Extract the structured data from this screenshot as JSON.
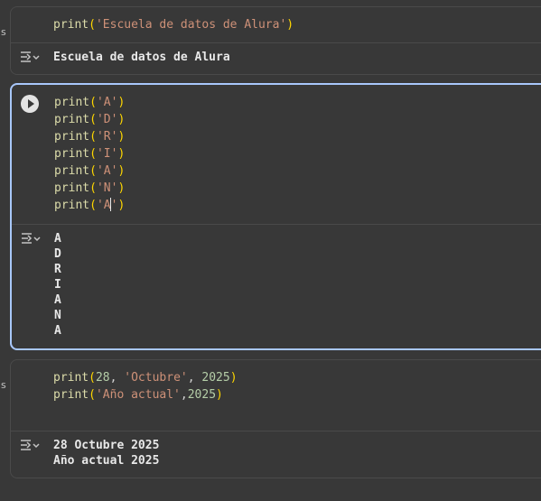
{
  "cells": [
    {
      "gutter": "s",
      "code_lines": [
        [
          {
            "t": "fn",
            "v": "print"
          },
          {
            "t": "paren",
            "v": "("
          },
          {
            "t": "str",
            "v": "'Escuela de datos de Alura'"
          },
          {
            "t": "paren",
            "v": ")"
          }
        ]
      ],
      "output": "Escuela de datos de Alura"
    },
    {
      "gutter": "",
      "code_lines": [
        [
          {
            "t": "fn",
            "v": "print"
          },
          {
            "t": "paren",
            "v": "("
          },
          {
            "t": "str",
            "v": "'A'"
          },
          {
            "t": "paren",
            "v": ")"
          }
        ],
        [
          {
            "t": "fn",
            "v": "print"
          },
          {
            "t": "paren",
            "v": "("
          },
          {
            "t": "str",
            "v": "'D'"
          },
          {
            "t": "paren",
            "v": ")"
          }
        ],
        [
          {
            "t": "fn",
            "v": "print"
          },
          {
            "t": "paren",
            "v": "("
          },
          {
            "t": "str",
            "v": "'R'"
          },
          {
            "t": "paren",
            "v": ")"
          }
        ],
        [
          {
            "t": "fn",
            "v": "print"
          },
          {
            "t": "paren",
            "v": "("
          },
          {
            "t": "str",
            "v": "'I'"
          },
          {
            "t": "paren",
            "v": ")"
          }
        ],
        [
          {
            "t": "fn",
            "v": "print"
          },
          {
            "t": "paren",
            "v": "("
          },
          {
            "t": "str",
            "v": "'A'"
          },
          {
            "t": "paren",
            "v": ")"
          }
        ],
        [
          {
            "t": "fn",
            "v": "print"
          },
          {
            "t": "paren",
            "v": "("
          },
          {
            "t": "str",
            "v": "'N'"
          },
          {
            "t": "paren",
            "v": ")"
          }
        ],
        [
          {
            "t": "fn",
            "v": "print"
          },
          {
            "t": "paren",
            "v": "("
          },
          {
            "t": "str",
            "v": "'A"
          },
          {
            "t": "caret",
            "v": ""
          },
          {
            "t": "str",
            "v": "'"
          },
          {
            "t": "paren",
            "v": ")"
          }
        ]
      ],
      "output": "A\nD\nR\nI\nA\nN\nA"
    },
    {
      "gutter": "s",
      "code_lines": [
        [
          {
            "t": "fn",
            "v": "print"
          },
          {
            "t": "paren",
            "v": "("
          },
          {
            "t": "num",
            "v": "28"
          },
          {
            "t": "pun",
            "v": ", "
          },
          {
            "t": "str",
            "v": "'Octubre'"
          },
          {
            "t": "pun",
            "v": ", "
          },
          {
            "t": "num",
            "v": "2025"
          },
          {
            "t": "paren",
            "v": ")"
          }
        ],
        [
          {
            "t": "fn",
            "v": "print"
          },
          {
            "t": "paren",
            "v": "("
          },
          {
            "t": "str",
            "v": "'Año actual'"
          },
          {
            "t": "pun",
            "v": ","
          },
          {
            "t": "num",
            "v": "2025"
          },
          {
            "t": "paren",
            "v": ")"
          }
        ]
      ],
      "output": "28 Octubre 2025\nAño actual 2025"
    }
  ],
  "icons": {
    "run": "play-circle-icon",
    "output": "output-toggle-icon"
  },
  "colors": {
    "background": "#383838",
    "active_border": "#a8c7fa",
    "keyword_fn": "#dcdcaa",
    "paren": "#ffd700",
    "string": "#ce9178",
    "number": "#b5cea8"
  }
}
